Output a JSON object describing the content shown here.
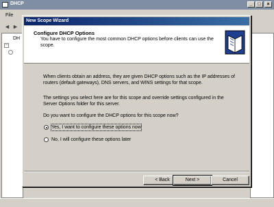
{
  "bg_window": {
    "title": "DHCP",
    "menu_first": "File",
    "tree_label": "DH"
  },
  "wizard": {
    "title": "New Scope Wizard",
    "header_title": "Configure DHCP Options",
    "header_subtitle": "You have to configure the most common DHCP options before clients can use the scope.",
    "para1": "When clients obtain an address, they are given DHCP options such as the IP addresses of routers (default gateways), DNS servers, and WINS settings for that scope.",
    "para2": "The settings you select here are for this scope and override settings configured in the Server Options folder for this server.",
    "question": "Do you want to configure the DHCP options for this scope now?",
    "options": [
      {
        "label": "Yes, I want to configure these options now",
        "selected": true
      },
      {
        "label": "No, I will configure these options later",
        "selected": false
      }
    ],
    "buttons": {
      "back": "< Back",
      "next": "Next >",
      "cancel": "Cancel"
    }
  }
}
